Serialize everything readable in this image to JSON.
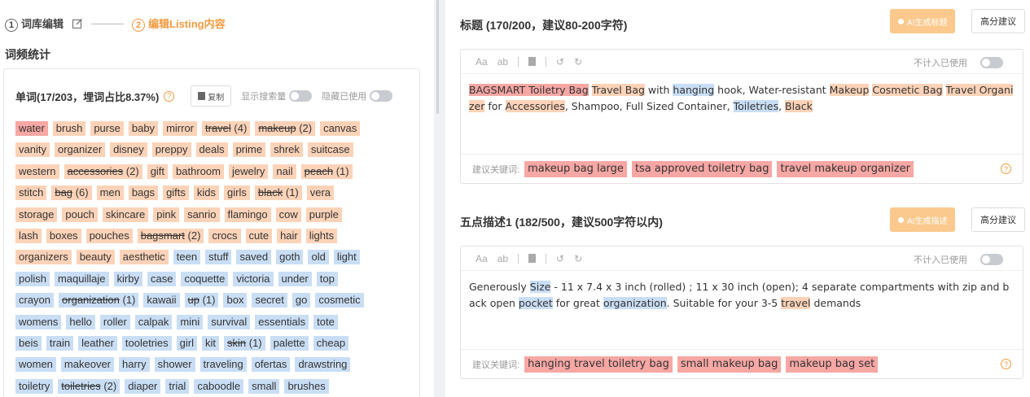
{
  "steps": {
    "step1": {
      "num": "1",
      "label": "词库编辑"
    },
    "step2": {
      "num": "2",
      "label": "编辑Listing内容"
    }
  },
  "freq_title": "词频统计",
  "words_card": {
    "header": "单词(17/203，埋词占比8.37%)",
    "copy_label": "复制",
    "show_volume_label": "显示搜索量",
    "hide_used_label": "隐藏已使用",
    "rows": [
      [
        {
          "t": "water",
          "c": "red"
        },
        {
          "t": "brush",
          "c": "orange"
        },
        {
          "t": "purse",
          "c": "orange"
        },
        {
          "t": "baby",
          "c": "orange"
        },
        {
          "t": "mirror",
          "c": "orange"
        },
        {
          "t": "travel",
          "c": "orange",
          "s": true,
          "n": "(4)"
        },
        {
          "t": "makeup",
          "c": "orange",
          "s": true,
          "n": "(2)"
        },
        {
          "t": "canvas",
          "c": "orange"
        }
      ],
      [
        {
          "t": "vanity",
          "c": "orange"
        },
        {
          "t": "organizer",
          "c": "orange"
        },
        {
          "t": "disney",
          "c": "orange"
        },
        {
          "t": "preppy",
          "c": "orange"
        },
        {
          "t": "deals",
          "c": "orange"
        },
        {
          "t": "prime",
          "c": "orange"
        },
        {
          "t": "shrek",
          "c": "orange"
        },
        {
          "t": "suitcase",
          "c": "orange"
        }
      ],
      [
        {
          "t": "western",
          "c": "orange"
        },
        {
          "t": "accessories",
          "c": "orange",
          "s": true,
          "n": "(2)"
        },
        {
          "t": "gift",
          "c": "orange"
        },
        {
          "t": "bathroom",
          "c": "orange"
        },
        {
          "t": "jewelry",
          "c": "orange"
        },
        {
          "t": "nail",
          "c": "orange"
        },
        {
          "t": "peach",
          "c": "orange",
          "s": true,
          "n": "(1)"
        }
      ],
      [
        {
          "t": "stitch",
          "c": "orange"
        },
        {
          "t": "bag",
          "c": "orange",
          "s": true,
          "n": "(6)"
        },
        {
          "t": "men",
          "c": "orange"
        },
        {
          "t": "bags",
          "c": "orange"
        },
        {
          "t": "gifts",
          "c": "orange"
        },
        {
          "t": "kids",
          "c": "orange"
        },
        {
          "t": "girls",
          "c": "orange"
        },
        {
          "t": "black",
          "c": "orange",
          "s": true,
          "n": "(1)"
        },
        {
          "t": "vera",
          "c": "orange"
        }
      ],
      [
        {
          "t": "storage",
          "c": "orange"
        },
        {
          "t": "pouch",
          "c": "orange"
        },
        {
          "t": "skincare",
          "c": "orange"
        },
        {
          "t": "pink",
          "c": "orange"
        },
        {
          "t": "sanrio",
          "c": "orange"
        },
        {
          "t": "flamingo",
          "c": "orange"
        },
        {
          "t": "cow",
          "c": "orange"
        },
        {
          "t": "purple",
          "c": "orange"
        }
      ],
      [
        {
          "t": "lash",
          "c": "orange"
        },
        {
          "t": "boxes",
          "c": "orange"
        },
        {
          "t": "pouches",
          "c": "orange"
        },
        {
          "t": "bagsmart",
          "c": "orange",
          "s": true,
          "n": "(2)"
        },
        {
          "t": "crocs",
          "c": "orange"
        },
        {
          "t": "cute",
          "c": "orange"
        },
        {
          "t": "hair",
          "c": "orange"
        },
        {
          "t": "lights",
          "c": "orange"
        }
      ],
      [
        {
          "t": "organizers",
          "c": "orange"
        },
        {
          "t": "beauty",
          "c": "orange"
        },
        {
          "t": "aesthetic",
          "c": "orange"
        },
        {
          "t": "teen",
          "c": "blue"
        },
        {
          "t": "stuff",
          "c": "blue"
        },
        {
          "t": "saved",
          "c": "blue"
        },
        {
          "t": "goth",
          "c": "blue"
        },
        {
          "t": "old",
          "c": "blue"
        },
        {
          "t": "light",
          "c": "blue"
        }
      ],
      [
        {
          "t": "polish",
          "c": "blue"
        },
        {
          "t": "maquillaje",
          "c": "blue"
        },
        {
          "t": "kirby",
          "c": "blue"
        },
        {
          "t": "case",
          "c": "blue"
        },
        {
          "t": "coquette",
          "c": "blue"
        },
        {
          "t": "victoria",
          "c": "blue"
        },
        {
          "t": "under",
          "c": "blue"
        },
        {
          "t": "top",
          "c": "blue"
        }
      ],
      [
        {
          "t": "crayon",
          "c": "blue"
        },
        {
          "t": "organization",
          "c": "blue",
          "s": true,
          "n": "(1)"
        },
        {
          "t": "kawaii",
          "c": "blue"
        },
        {
          "t": "up",
          "c": "blue",
          "s": true,
          "n": "(1)"
        },
        {
          "t": "box",
          "c": "blue"
        },
        {
          "t": "secret",
          "c": "blue"
        },
        {
          "t": "go",
          "c": "blue"
        },
        {
          "t": "cosmetic",
          "c": "blue"
        }
      ],
      [
        {
          "t": "womens",
          "c": "blue"
        },
        {
          "t": "hello",
          "c": "blue"
        },
        {
          "t": "roller",
          "c": "blue"
        },
        {
          "t": "calpak",
          "c": "blue"
        },
        {
          "t": "mini",
          "c": "blue"
        },
        {
          "t": "survival",
          "c": "blue"
        },
        {
          "t": "essentials",
          "c": "blue"
        },
        {
          "t": "tote",
          "c": "blue"
        }
      ],
      [
        {
          "t": "beis",
          "c": "blue"
        },
        {
          "t": "train",
          "c": "blue"
        },
        {
          "t": "leather",
          "c": "blue"
        },
        {
          "t": "tooletries",
          "c": "blue"
        },
        {
          "t": "girl",
          "c": "blue"
        },
        {
          "t": "kit",
          "c": "blue"
        },
        {
          "t": "skin",
          "c": "blue",
          "s": true,
          "n": "(1)"
        },
        {
          "t": "palette",
          "c": "blue"
        },
        {
          "t": "cheap",
          "c": "blue"
        }
      ],
      [
        {
          "t": "women",
          "c": "blue"
        },
        {
          "t": "makeover",
          "c": "blue"
        },
        {
          "t": "harry",
          "c": "blue"
        },
        {
          "t": "shower",
          "c": "blue"
        },
        {
          "t": "traveling",
          "c": "blue"
        },
        {
          "t": "ofertas",
          "c": "blue"
        },
        {
          "t": "drawstring",
          "c": "blue"
        }
      ],
      [
        {
          "t": "toiletry",
          "c": "blue"
        },
        {
          "t": "toiletries",
          "c": "blue",
          "s": true,
          "n": "(2)"
        },
        {
          "t": "diaper",
          "c": "blue"
        },
        {
          "t": "trial",
          "c": "blue"
        },
        {
          "t": "caboodle",
          "c": "blue"
        },
        {
          "t": "small",
          "c": "blue"
        },
        {
          "t": "brushes",
          "c": "blue"
        }
      ]
    ]
  },
  "title_block": {
    "heading": "标题 (170/200，建议80-200字符)",
    "ai_button": "AI生成标题",
    "score_button": "高分建议",
    "toolbar": {
      "aa": "Aa",
      "ab": "ab",
      "undo": "↺",
      "redo": "↻",
      "not_counted": "不计入已使用"
    },
    "segments": [
      {
        "t": "BAGSMART Toiletry Bag",
        "h": "r"
      },
      {
        "t": " "
      },
      {
        "t": "Travel Bag",
        "h": "o"
      },
      {
        "t": " with "
      },
      {
        "t": "hanging",
        "h": "b"
      },
      {
        "t": " hook, Water-resistant "
      },
      {
        "t": "Makeup",
        "h": "o"
      },
      {
        "t": " "
      },
      {
        "t": "Cosmetic Bag",
        "h": "o"
      },
      {
        "t": " "
      },
      {
        "t": "Travel Organizer",
        "h": "o"
      },
      {
        "t": " for "
      },
      {
        "t": "Accessories",
        "h": "o"
      },
      {
        "t": ", Shampoo, Full Sized Container, "
      },
      {
        "t": "Toiletries",
        "h": "b"
      },
      {
        "t": ", "
      },
      {
        "t": "Black",
        "h": "o"
      }
    ],
    "suggest_label": "建议关键词:",
    "keywords": [
      "makeup bag large",
      "tsa approved toiletry bag",
      "travel makeup organizer"
    ]
  },
  "bullet_block": {
    "heading": "五点描述1 (182/500，建议500字符以内)",
    "ai_button": "AI生成描述",
    "score_button": "高分建议",
    "toolbar": {
      "aa": "Aa",
      "ab": "ab",
      "undo": "↺",
      "redo": "↻",
      "not_counted": "不计入已使用"
    },
    "segments": [
      {
        "t": "Generously "
      },
      {
        "t": "Size",
        "h": "b"
      },
      {
        "t": " - 11 x 7.4 x 3 inch (rolled) ; 11 x 30 inch (open); 4 separate compartments with zip and back open "
      },
      {
        "t": "pocket",
        "h": "b"
      },
      {
        "t": " for great "
      },
      {
        "t": "organization",
        "h": "b"
      },
      {
        "t": ". Suitable for your 3-5 "
      },
      {
        "t": "travel",
        "h": "o"
      },
      {
        "t": " demands"
      }
    ],
    "suggest_label": "建议关键词:",
    "keywords": [
      "hanging travel toiletry bag",
      "small makeup bag",
      "makeup bag set"
    ]
  },
  "colors": {
    "accent": "#f29a3f",
    "ai_button": "#fbc98d",
    "red_tag": "#f7a7a4",
    "orange_tag": "#fcd3b8",
    "blue_tag": "#c9def5"
  },
  "icons": [
    "edit-icon",
    "question-icon",
    "copy-icon",
    "bulb-icon",
    "clipboard-icon",
    "undo-icon",
    "redo-icon"
  ]
}
